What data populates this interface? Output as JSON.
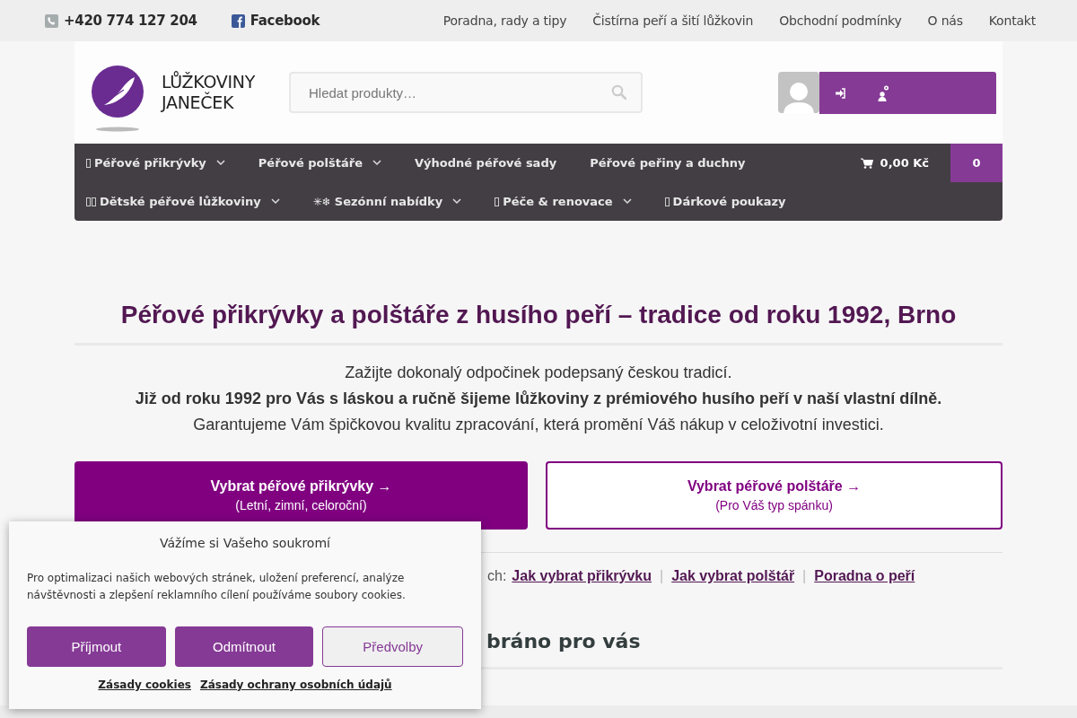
{
  "top_bar": {
    "phone": "+420 774 127 204",
    "facebook": "Facebook",
    "links": [
      "Poradna, rady a tipy",
      "Čistírna peří a šití lůžkovin",
      "Obchodní podmínky",
      "O nás",
      "Kontakt"
    ]
  },
  "header": {
    "logo_lines": [
      "LŮŽKOVINY",
      "JANEČEK"
    ],
    "search": {
      "placeholder": "Hledat produkty…"
    }
  },
  "nav": {
    "rows": [
      [
        {
          "label": "Péřové přikrývky",
          "has_dropdown": true,
          "kind": "boxed"
        },
        {
          "label": "Péřové polštáře",
          "has_dropdown": true,
          "kind": "plain"
        },
        {
          "label": "Výhodné péřové sady",
          "has_dropdown": false,
          "kind": "plain"
        },
        {
          "label": "Péřové peřiny a duchny",
          "has_dropdown": false,
          "kind": "plain"
        }
      ],
      [
        {
          "label": "Dětské péřové lůžkoviny",
          "has_dropdown": true,
          "kind": "doubleboxed"
        },
        {
          "label": "Sezónní nabídky",
          "has_dropdown": true,
          "kind": "symbol",
          "icon_text": "✳❄"
        },
        {
          "label": "Péče & renovace",
          "has_dropdown": true,
          "kind": "boxed"
        },
        {
          "label": "Dárkové poukazy",
          "has_dropdown": false,
          "kind": "boxed"
        }
      ]
    ],
    "cart": {
      "total": "0,00 Kč",
      "count": "0"
    }
  },
  "hero": {
    "title": "Péřové přikrývky a polštáře z husího peří – tradice od roku 1992, Brno",
    "lines": [
      {
        "text": "Zažijte dokonalý odpočinek podepsaný českou tradicí.",
        "kind": "plain"
      },
      {
        "text": "Již od roku 1992 pro Vás s láskou a ručně šijeme lůžkoviny z prémiového husího peří v naší vlastní dílně.",
        "kind": "bold"
      },
      {
        "text": "Garantujeme Vám špičkovou kvalitu zpracování, která promění Váš nákup v celoživotní investici.",
        "kind": "plain"
      }
    ],
    "buttons": [
      {
        "title": "Vybrat péřové přikrývky →",
        "subtitle": "(Letní, zimní, celoroční)",
        "kind": "filled"
      },
      {
        "title": "Vybrat péřové polštáře →",
        "subtitle": "(Pro Váš typ spánku)",
        "kind": "outline"
      }
    ]
  },
  "guides": {
    "prefix": "ch:",
    "items": [
      {
        "text": "Jak vybrat přikrývku",
        "kind": "link"
      },
      {
        "text": "|",
        "kind": "separator"
      },
      {
        "text": "Jak vybrat polštář",
        "kind": "link"
      },
      {
        "text": "|",
        "kind": "separator"
      },
      {
        "text": "Poradna o peří",
        "kind": "link"
      }
    ]
  },
  "section_heading": "bráno pro vás",
  "cookie_banner": {
    "title": "Vážíme si Vašeho soukromí",
    "text": "Pro optimalizaci našich webových stránek, uložení preferencí, analýze návštěvnosti a zlepšení reklamního cílení používáme soubory cookies.",
    "buttons": [
      {
        "label": "Příjmout",
        "kind": "primary"
      },
      {
        "label": "Odmítnout",
        "kind": "primary"
      },
      {
        "label": "Předvolby",
        "kind": "secondary"
      }
    ],
    "links": [
      "Zásady cookies",
      "Zásady ochrany osobních údajů"
    ]
  }
}
